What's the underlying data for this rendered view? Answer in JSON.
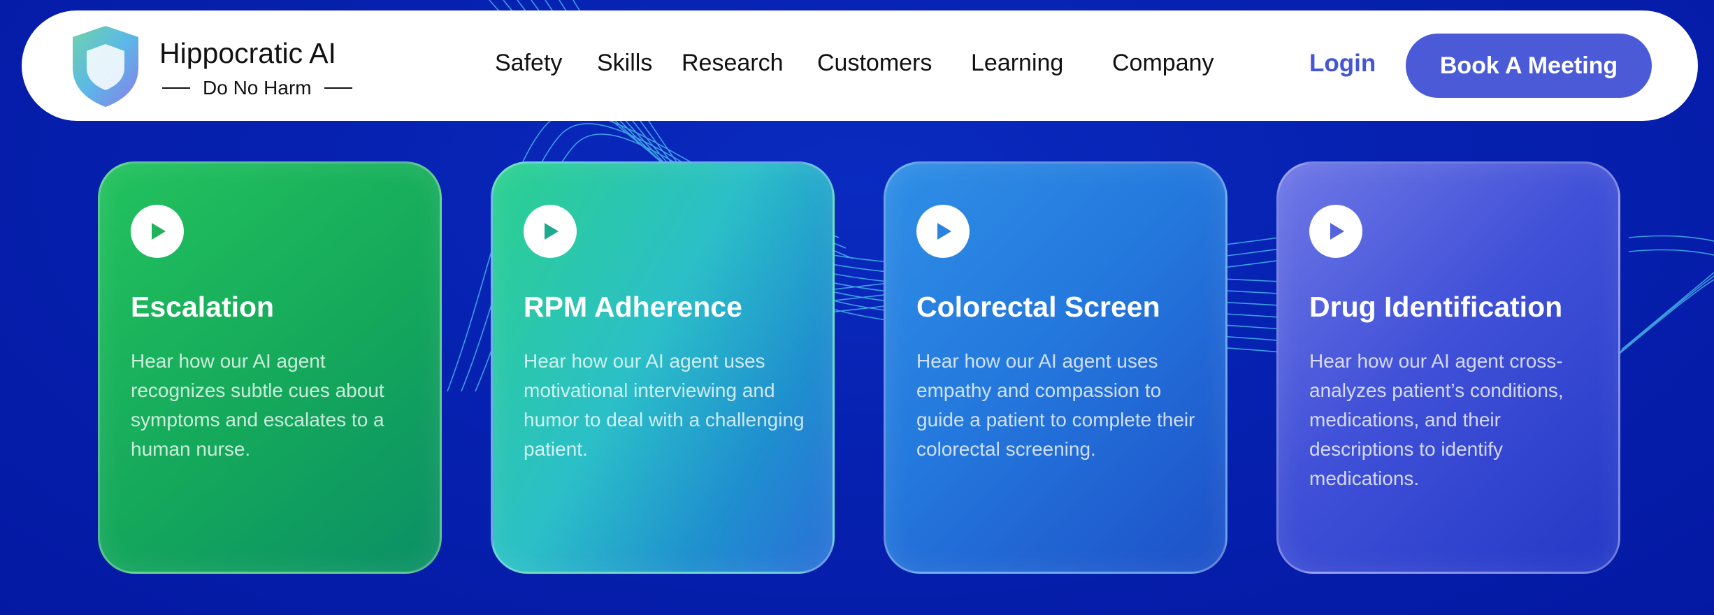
{
  "brand": {
    "name": "Hippocratic AI",
    "tagline": "Do No Harm"
  },
  "nav": {
    "links": [
      "Safety",
      "Skills",
      "Research",
      "Customers",
      "Learning",
      "Company"
    ],
    "login": "Login",
    "cta": "Book A Meeting"
  },
  "cards": [
    {
      "title": "Escalation",
      "description": "Hear how our AI agent recognizes subtle cues about symptoms and escalates to a human nurse."
    },
    {
      "title": "RPM Adherence",
      "description": "Hear how our AI agent uses motivational interviewing and humor to deal with a challenging patient."
    },
    {
      "title": "Colorectal Screen",
      "description": "Hear how our AI agent uses empathy and compassion to guide a patient to complete their colorectal screening."
    },
    {
      "title": "Drug Identification",
      "description": "Hear how our AI agent cross-analyzes patient’s conditions, medications, and their descriptions to identify medications."
    }
  ],
  "colors": {
    "background": "#0621b0",
    "accent": "#4b5bd7",
    "login": "#4456d6"
  }
}
